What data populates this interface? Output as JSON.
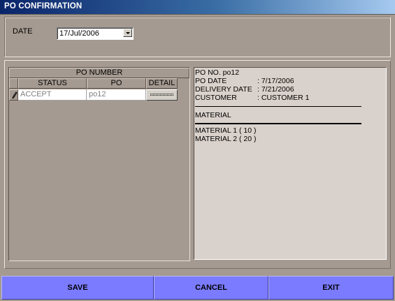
{
  "window": {
    "title": "PO CONFIRMATION"
  },
  "filter": {
    "date_label": "DATE",
    "date_value": "17/Jul/2006"
  },
  "grid": {
    "group_header": "PO NUMBER",
    "columns": [
      "STATUS",
      "PO",
      "DETAIL"
    ],
    "rows": [
      {
        "status": "ACCEPT",
        "po": "po12"
      }
    ]
  },
  "detail": {
    "po_no_line": "PO NO. po12",
    "fields": [
      {
        "label": "PO DATE",
        "value": ": 7/17/2006"
      },
      {
        "label": "DELIVERY DATE",
        "value": ": 7/21/2006"
      },
      {
        "label": "CUSTOMER",
        "value": ": CUSTOMER 1"
      }
    ],
    "material_header": "MATERIAL",
    "materials": [
      "MATERIAL 1 ( 10 )",
      "MATERIAL 2 ( 20 )"
    ]
  },
  "actions": {
    "save": "SAVE",
    "cancel": "CANCEL",
    "exit": "EXIT"
  },
  "colors": {
    "button_bg": "#7b7bff",
    "form_bg": "#a59a91",
    "detail_bg": "#d9d1cb"
  }
}
